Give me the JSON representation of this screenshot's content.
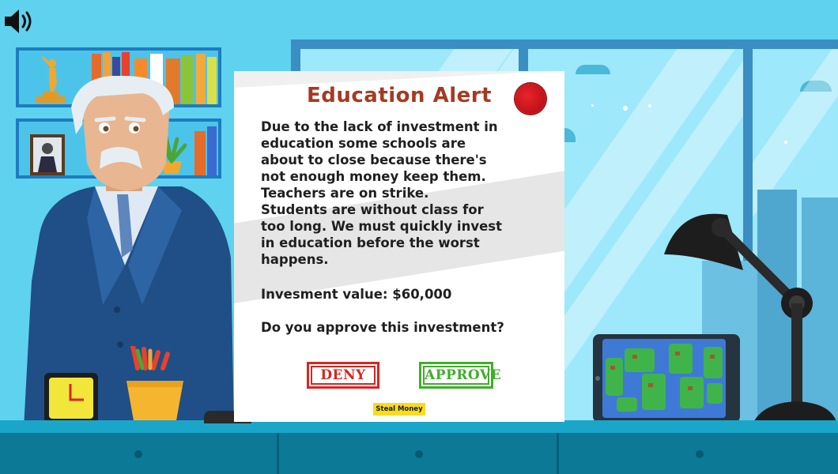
{
  "alert": {
    "title": "Education Alert",
    "body_lines": [
      "Due to the lack of investment in",
      "education some schools are",
      "about to close because there's",
      "not enough money keep them.",
      "Teachers are on strike.",
      "Students are without class for",
      "too long. We must quickly invest",
      "in education before the worst",
      "happens."
    ],
    "investment_value": "Invesment value: $60,000",
    "question": "Do you approve this investment?",
    "deny_label": "DENY",
    "approve_label": "APPROVE",
    "steal_label": "Steal Money"
  },
  "colors": {
    "title": "#a53a22",
    "deny": "#d9251f",
    "approve": "#3fae2a",
    "steal_bg": "#f7dc1f",
    "wall": "#5ed2ef",
    "desk": "#0c7a97"
  },
  "icons": {
    "sound": "speaker-volume-icon",
    "seal": "wax-seal-icon",
    "clock": "clock-icon"
  }
}
